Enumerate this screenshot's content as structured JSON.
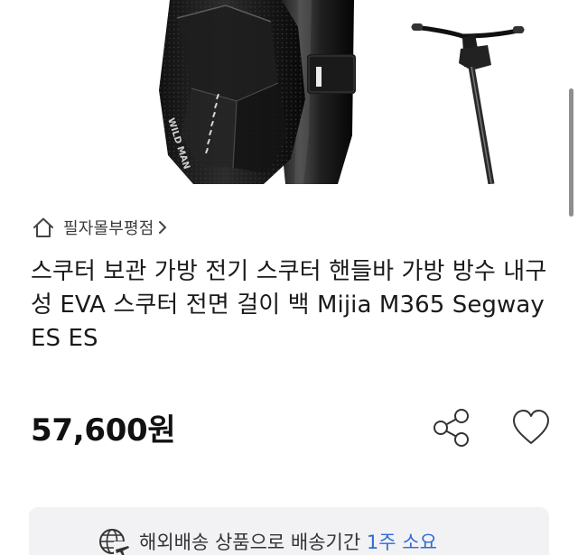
{
  "product": {
    "store_name": "필자몰부평점",
    "title": "스쿠터 보관 가방 전기 스쿠터 핸들바 가방 방수 내구성 EVA 스쿠터 전면 걸이 백 Mijia M365 Segway ES ES",
    "price": "57,600원",
    "image_text": "WILD MAN"
  },
  "icons": {
    "store": "home-icon",
    "store_link": "chevron-right-icon",
    "share": "share-icon",
    "wishlist": "heart-icon",
    "shipping": "globe-airplane-icon"
  },
  "shipping": {
    "text": "해외배송 상품으로 배송기간",
    "duration": "1주 소요"
  },
  "colors": {
    "accent": "#2f6bd6",
    "banner_background": "#f2f2f4",
    "text": "#1a1a1a",
    "muted_text": "#3a3a3a"
  }
}
